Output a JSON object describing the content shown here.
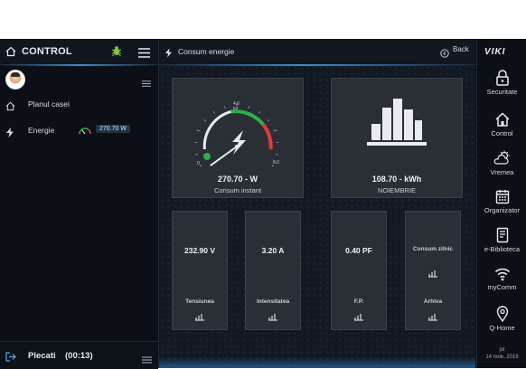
{
  "left_panel": {
    "title": "CONTROL",
    "nav": [
      {
        "label": "Planul casei",
        "icon": "home-icon"
      },
      {
        "label": "Energie",
        "icon": "bolt-icon",
        "badge": "270.70 W"
      }
    ],
    "footer": {
      "status": "Plecati",
      "timer": "(00:13)"
    }
  },
  "main": {
    "title": "Consum energie",
    "back_label": "Back",
    "instant": {
      "value": "270.70 - W",
      "caption": "Consum instant",
      "gauge_unit": "kw",
      "gauge_min": "0",
      "gauge_mid": "4.0",
      "gauge_max": "8.0",
      "gauge_level_kw": 0.27
    },
    "monthly": {
      "value": "108.70 - kWh",
      "caption": "NOIEMBRIE"
    },
    "tiles": [
      {
        "value": "232.90 V",
        "caption": "Tensiunea"
      },
      {
        "value": "3.20 A",
        "caption": "Intensitatea"
      },
      {
        "value": "0.40 PF",
        "caption": "F.P."
      },
      {
        "value": "",
        "caption": "Consum zilnic",
        "caption2": "Arhiva"
      }
    ]
  },
  "rail": {
    "logo": "VIKI",
    "items": [
      {
        "label": "Securitate",
        "icon": "lock-icon"
      },
      {
        "label": "Control",
        "icon": "home-icon"
      },
      {
        "label": "Vremea",
        "icon": "weather-icon"
      },
      {
        "label": "Organizator",
        "icon": "calendar-icon"
      },
      {
        "label": "e-Biblioteca",
        "icon": "book-icon"
      },
      {
        "label": "myComm",
        "icon": "wifi-icon"
      },
      {
        "label": "Q-Home",
        "icon": "location-pin-icon"
      }
    ],
    "footer_day": "joi",
    "footer_date": "14 noie. 2019"
  },
  "colors": {
    "accent_blue": "#3a8fd0",
    "gauge_green": "#2fae4a",
    "gauge_red": "#e23b3b",
    "card_bg": "#2a2f35"
  }
}
